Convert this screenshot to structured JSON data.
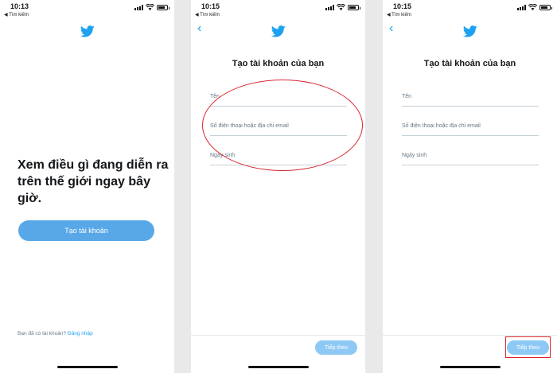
{
  "colors": {
    "brand": "#1da1f2",
    "button": "#58a8e8",
    "button_disabled": "#8ec9f5",
    "highlight": "#d9262e"
  },
  "screens": [
    {
      "status": {
        "time": "10:13",
        "back_app": "◀ Tìm kiếm"
      },
      "icon": "twitter-bird-icon",
      "headline": "Xem điều gì đang diễn ra trên thế giới ngay bây giờ.",
      "create_account_button": "Tạo tài khoản",
      "login_prompt": "Bạn đã có tài khoản?",
      "login_link": "Đăng nhập"
    },
    {
      "status": {
        "time": "10:15",
        "back_app": "◀ Tìm kiếm"
      },
      "back_icon": "chevron-left-icon",
      "title": "Tạo tài khoản của bạn",
      "fields": {
        "name": "Tên",
        "contact": "Số điện thoại hoặc địa chỉ email",
        "birthdate": "Ngày sinh"
      },
      "next_button": "Tiếp theo"
    },
    {
      "status": {
        "time": "10:15",
        "back_app": "◀ Tìm kiếm"
      },
      "back_icon": "chevron-left-icon",
      "title": "Tạo tài khoản của bạn",
      "fields": {
        "name": "Tên",
        "contact": "Số điện thoại hoặc địa chỉ email",
        "birthdate": "Ngày sinh"
      },
      "next_button": "Tiếp theo"
    }
  ]
}
